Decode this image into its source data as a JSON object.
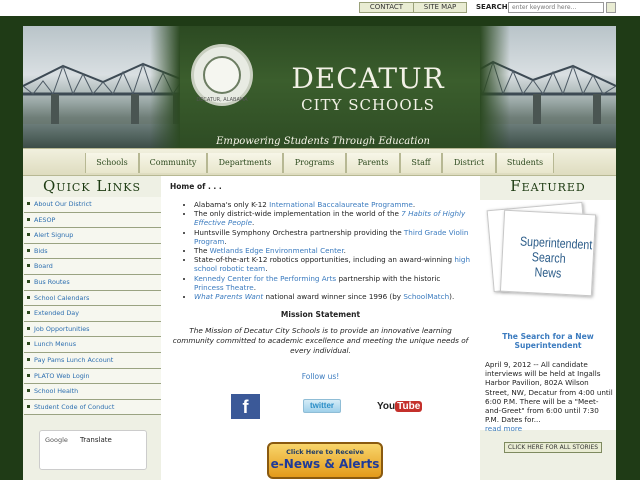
{
  "topbar": {
    "contact_label": "CONTACT",
    "sitemap_label": "SITE MAP",
    "search_label": "SEARCH",
    "search_placeholder": "enter keyword here..."
  },
  "banner": {
    "title": "DECATUR",
    "subtitle": "CITY SCHOOLS",
    "tagline": "Empowering Students Through Education",
    "seal_text": "DECATUR, ALABAMA"
  },
  "nav": {
    "items": [
      {
        "label": "Schools"
      },
      {
        "label": "Community"
      },
      {
        "label": "Departments"
      },
      {
        "label": "Programs"
      },
      {
        "label": "Parents"
      },
      {
        "label": "Staff"
      },
      {
        "label": "District"
      },
      {
        "label": "Students"
      }
    ]
  },
  "quick_links": {
    "title": "Quick Links",
    "items": [
      {
        "label": "About Our District"
      },
      {
        "label": "AESOP"
      },
      {
        "label": "Alert Signup"
      },
      {
        "label": "Bids"
      },
      {
        "label": "Board"
      },
      {
        "label": "Bus Routes"
      },
      {
        "label": "School Calendars"
      },
      {
        "label": "Extended Day"
      },
      {
        "label": "Job Opportunities"
      },
      {
        "label": "Lunch Menus"
      },
      {
        "label": "Pay Pams Lunch Account"
      },
      {
        "label": "PLATO Web Login"
      },
      {
        "label": "School Health"
      },
      {
        "label": "Student Code of Conduct"
      }
    ],
    "translate_brand": "Google",
    "translate_label": "Translate"
  },
  "main": {
    "home_title": "Home of . . .",
    "bullets": {
      "b1_pre": "Alabama's only K-12 ",
      "b1_link": "International Baccalaureate Programme",
      "b1_post": ".",
      "b2_pre": "The only district-wide implementation in the world of the ",
      "b2_link": "7 Habits of Highly Effective People",
      "b2_post": ".",
      "b3_pre": "Huntsville Symphony Orchestra partnership providing the ",
      "b3_link": "Third Grade Violin Program",
      "b3_post": ".",
      "b4_pre": "The ",
      "b4_link": "Wetlands Edge Environmental Center",
      "b4_post": ".",
      "b5_pre": "State-of-the-art K-12 robotics opportunities, including an award-winning ",
      "b5_link": "high school robotic team",
      "b5_post": ".",
      "b6_link": "Kennedy Center for the Performing Arts",
      "b6_mid": " partnership with the historic ",
      "b6_link2": "Princess Theatre",
      "b6_post": ".",
      "b7_link": "What Parents Want",
      "b7_mid": " national award winner since 1996 (by ",
      "b7_link2": "SchoolMatch",
      "b7_post": ")."
    },
    "mission_heading": "Mission Statement",
    "mission_text": "The Mission of Decatur City Schools is to provide an innovative learning community committed to academic excellence and meeting the unique needs of every individual.",
    "follow_label": "Follow us!",
    "facebook_glyph": "f",
    "twitter_label": "twitter",
    "youtube_you": "You",
    "youtube_tube": "Tube",
    "enews_top": "Click Here to Receive",
    "enews_main": "e-News & Alerts"
  },
  "featured": {
    "title": "Featured",
    "image_text_1": "Superintendent",
    "image_text_2": "Search News",
    "headline": "The Search for a New Superintendent",
    "body": "April 9, 2012 -- All candidate interviews will be held at Ingalls Harbor Pavilion, 802A Wilson Street, NW, Decatur from 4:00 until 6:00 P.M. There will be a \"Meet-and-Greet\" from 6:00 until 7:30 P.M. Dates for...",
    "read_more": "read more",
    "all_stories": "CLICK HERE FOR ALL STORIES"
  },
  "colors": {
    "frame_green": "#1f3b16",
    "link_blue": "#3b7bbf",
    "nav_text": "#2d4a1e"
  }
}
